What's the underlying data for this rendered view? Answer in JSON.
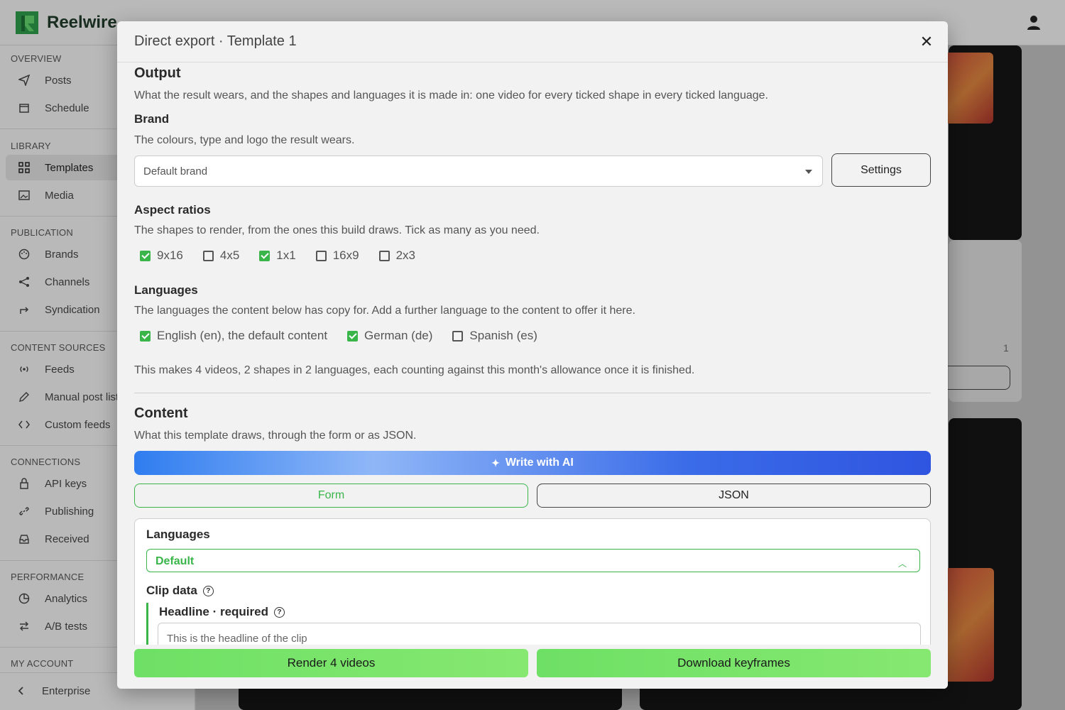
{
  "app": {
    "name": "Reelwire"
  },
  "sidebar": {
    "sections": [
      {
        "title": "OVERVIEW",
        "items": [
          {
            "label": "Posts",
            "icon": "send-icon"
          },
          {
            "label": "Schedule",
            "icon": "calendar-icon"
          }
        ]
      },
      {
        "title": "LIBRARY",
        "items": [
          {
            "label": "Templates",
            "icon": "grid-icon"
          },
          {
            "label": "Media",
            "icon": "image-icon"
          }
        ]
      },
      {
        "title": "PUBLICATION",
        "items": [
          {
            "label": "Brands",
            "icon": "palette-icon"
          },
          {
            "label": "Channels",
            "icon": "share-icon"
          },
          {
            "label": "Syndication",
            "icon": "forward-icon"
          }
        ]
      },
      {
        "title": "CONTENT SOURCES",
        "items": [
          {
            "label": "Feeds",
            "icon": "broadcast-icon"
          },
          {
            "label": "Manual post lists",
            "icon": "pencil-icon"
          },
          {
            "label": "Custom feeds",
            "icon": "code-icon"
          }
        ]
      },
      {
        "title": "CONNECTIONS",
        "items": [
          {
            "label": "API keys",
            "icon": "lock-icon"
          },
          {
            "label": "Publishing",
            "icon": "link-icon"
          },
          {
            "label": "Received",
            "icon": "inbox-icon"
          }
        ]
      },
      {
        "title": "PERFORMANCE",
        "items": [
          {
            "label": "Analytics",
            "icon": "pie-icon"
          },
          {
            "label": "A/B tests",
            "icon": "swap-icon"
          }
        ]
      },
      {
        "title": "MY ACCOUNT",
        "items": []
      }
    ],
    "footer": {
      "label": "Enterprise"
    }
  },
  "background": {
    "count_text": "1"
  },
  "modal": {
    "title": "Direct export · Template 1",
    "output": {
      "heading": "Output",
      "description": "What the result wears, and the shapes and languages it is made in: one video for every ticked shape in every ticked language."
    },
    "brand": {
      "heading": "Brand",
      "description": "The colours, type and logo the result wears.",
      "selected": "Default brand",
      "settings_label": "Settings"
    },
    "aspect": {
      "heading": "Aspect ratios",
      "description": "The shapes to render, from the ones this build draws. Tick as many as you need.",
      "options": [
        {
          "label": "9x16",
          "checked": true
        },
        {
          "label": "4x5",
          "checked": false
        },
        {
          "label": "1x1",
          "checked": true
        },
        {
          "label": "16x9",
          "checked": false
        },
        {
          "label": "2x3",
          "checked": false
        }
      ]
    },
    "languages": {
      "heading": "Languages",
      "description": "The languages the content below has copy for. Add a further language to the content to offer it here.",
      "options": [
        {
          "label": "English (en), the default content",
          "checked": true
        },
        {
          "label": "German (de)",
          "checked": true
        },
        {
          "label": "Spanish (es)",
          "checked": false
        }
      ]
    },
    "summary": "This makes 4 videos, 2 shapes in 2 languages, each counting against this month's allowance once it is finished.",
    "content": {
      "heading": "Content",
      "description": "What this template draws, through the form or as JSON.",
      "ai_label": "Write with AI",
      "tabs": {
        "form": "Form",
        "json": "JSON"
      },
      "form": {
        "languages_label": "Languages",
        "language_selected": "Default",
        "clip_data_label": "Clip data",
        "headline_label": "Headline · required",
        "headline_placeholder": "This is the headline of the clip"
      }
    },
    "actions": {
      "render": "Render 4 videos",
      "keyframes": "Download keyframes"
    }
  },
  "colors": {
    "accent": "#39b54a",
    "ai_gradient_start": "#2f7df0",
    "ai_gradient_end": "#2f55e0",
    "action_green": "#6ee065"
  }
}
